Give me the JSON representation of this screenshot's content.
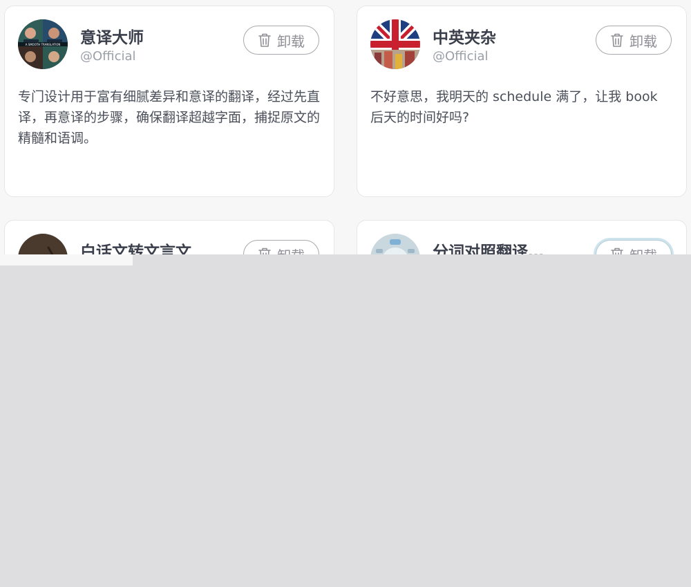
{
  "cards": [
    {
      "title": "意译大师",
      "author": "@Official",
      "action_label": "卸载",
      "description": "专门设计用于富有细腻差异和意译的翻译，经过先直译，再意译的步骤，确保翻译超越字面，捕捉原文的精髓和语调。",
      "avatar_text": "A SMOOTH TRANSLATION"
    },
    {
      "title": "中英夹杂",
      "author": "@Official",
      "action_label": "卸载",
      "description": "不好意思，我明天的 schedule 满了，让我 book 后天的时间好吗?"
    },
    {
      "title": "白话文转文言文",
      "action_label": "卸载"
    },
    {
      "title": "分词对照翻译…",
      "action_label": "卸载"
    }
  ],
  "colors": {
    "card_border": "#e6e6ea",
    "title": "#3a3f4b",
    "muted": "#9aa0a8",
    "overlay": "#dedee0"
  }
}
